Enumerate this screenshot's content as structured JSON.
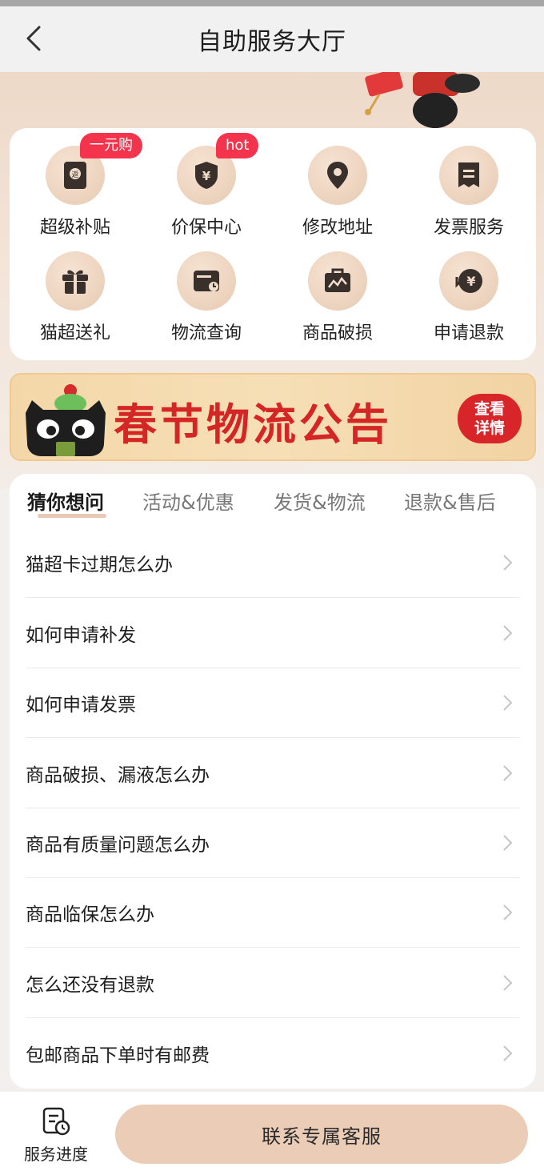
{
  "header": {
    "title": "自助服务大厅"
  },
  "services": [
    {
      "label": "超级补贴",
      "icon": "rebate-envelope-icon",
      "badge": "一元购"
    },
    {
      "label": "价保中心",
      "icon": "shield-yen-icon",
      "badge": "hot"
    },
    {
      "label": "修改地址",
      "icon": "location-pin-icon",
      "badge": ""
    },
    {
      "label": "发票服务",
      "icon": "invoice-icon",
      "badge": ""
    },
    {
      "label": "猫超送礼",
      "icon": "gift-icon",
      "badge": ""
    },
    {
      "label": "物流查询",
      "icon": "logistics-card-icon",
      "badge": ""
    },
    {
      "label": "商品破损",
      "icon": "broken-package-icon",
      "badge": ""
    },
    {
      "label": "申请退款",
      "icon": "refund-yen-icon",
      "badge": ""
    }
  ],
  "banner": {
    "title": "春节物流公告",
    "button_line1": "查看",
    "button_line2": "详情"
  },
  "tabs": [
    {
      "label": "猜你想问",
      "active": true
    },
    {
      "label": "活动&优惠",
      "active": false
    },
    {
      "label": "发货&物流",
      "active": false
    },
    {
      "label": "退款&售后",
      "active": false
    }
  ],
  "faq": [
    "猫超卡过期怎么办",
    "如何申请补发",
    "如何申请发票",
    "商品破损、漏液怎么办",
    "商品有质量问题怎么办",
    "商品临保怎么办",
    "怎么还没有退款",
    "包邮商品下单时有邮费"
  ],
  "bottom": {
    "progress_label": "服务进度",
    "contact_label": "联系专属客服"
  },
  "colors": {
    "accent_bg": "#ebcdb7",
    "badge_red": "#f4344d",
    "banner_red": "#d32625"
  }
}
